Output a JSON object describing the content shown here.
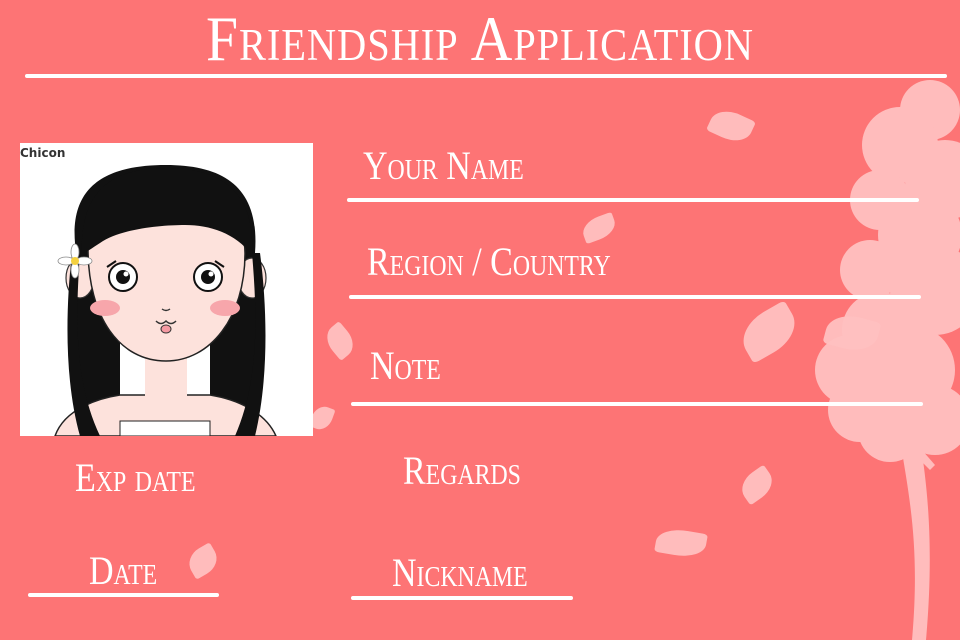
{
  "header": {
    "title": "Friendship Application"
  },
  "photo": {
    "caption": "Chicon"
  },
  "fields": {
    "name_label": "Your Name",
    "region_label": "Region / Country",
    "note_label": "Note",
    "regards_label": "Regards",
    "nickname_label": "Nickname",
    "exp_date_label": "Exp date",
    "date_label": "Date"
  },
  "colors": {
    "background": "#fd7475",
    "accent": "#ffc0c0",
    "text": "#ffffff"
  }
}
